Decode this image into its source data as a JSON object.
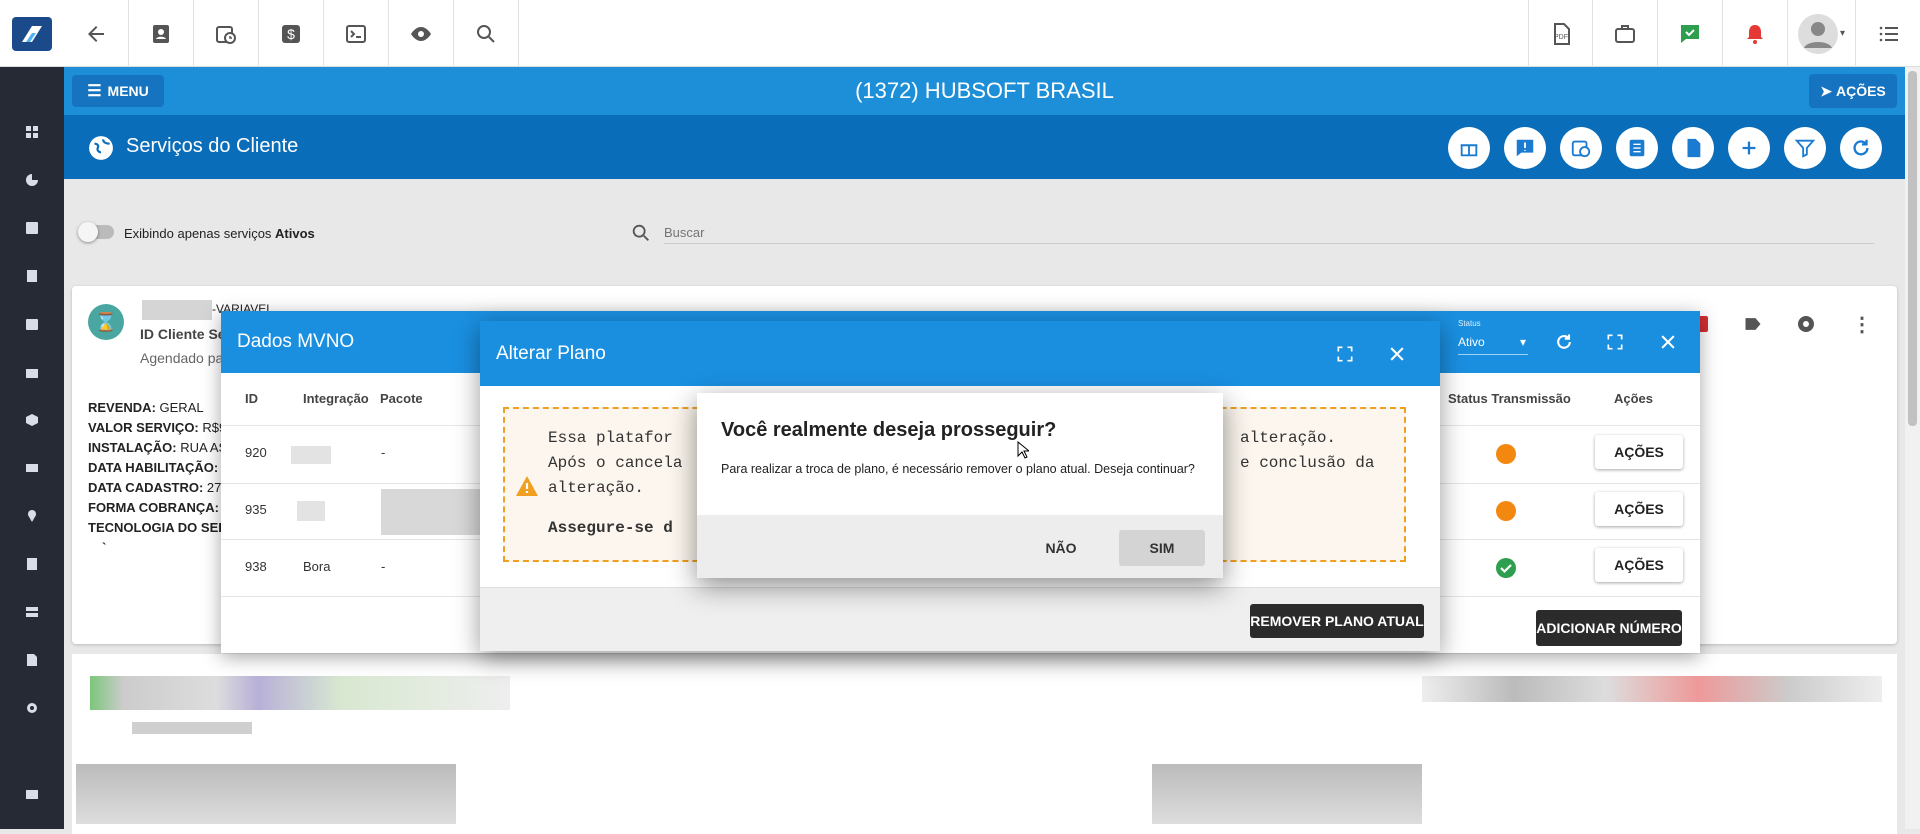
{
  "header": {
    "title": "(1372) HUBSOFT BRASIL",
    "menu_label": "MENU",
    "actions_label": "AÇÕES"
  },
  "subheader": {
    "title": "Serviços do Cliente"
  },
  "filter": {
    "label_prefix": "Exibindo apenas serviços ",
    "label_bold": "Ativos",
    "search_placeholder": "Buscar"
  },
  "card": {
    "name_suffix": "-VARIAVEL",
    "id_label": "ID Cliente Se",
    "agendado": "Agendado pa",
    "lines": [
      {
        "label": "REVENDA:",
        "value": " GERAL"
      },
      {
        "label": "VALOR SERVIÇO:",
        "value": " R$9"
      },
      {
        "label": "INSTALAÇÃO:",
        "value": " RUA AS"
      },
      {
        "label": "DATA HABILITAÇÃO:",
        "value": ""
      },
      {
        "label": "DATA CADASTRO:",
        "value": " 27"
      },
      {
        "label": "FORMA COBRANÇA:",
        "value": ""
      },
      {
        "label": "TECNOLOGIA DO SER",
        "value": ""
      }
    ],
    "tick": "`"
  },
  "mvno": {
    "title": "Dados MVNO",
    "status_label": "Status",
    "status_value": "Ativo",
    "columns": {
      "id": "ID",
      "integracao": "Integração",
      "pacote": "Pacote",
      "status": "Status Transmissão",
      "acoes": "Ações"
    },
    "rows": [
      {
        "id": "920",
        "integracao": "",
        "pacote": "-",
        "status_color": "#f2880f"
      },
      {
        "id": "935",
        "integracao": "",
        "pacote": "",
        "status_color": "#f2880f"
      },
      {
        "id": "938",
        "integracao": "Bora",
        "pacote": "-",
        "status_color": "#2e9e4f"
      }
    ],
    "row_action": "AÇÕES",
    "add_button": "ADICIONAR NÚMERO"
  },
  "alterar": {
    "title": "Alterar Plano",
    "warn_line1a": "Essa platafor",
    "warn_line1b": "alteração.",
    "warn_line2a": "Após o cancela",
    "warn_line2b": "e conclusão da",
    "warn_line3": "alteração.",
    "warn_bold": "Assegure-se d",
    "remove_button": "REMOVER PLANO ATUAL"
  },
  "confirm": {
    "title": "Você realmente deseja prosseguir?",
    "message": "Para realizar a troca de plano, é necessário remover o plano atual. Deseja continuar?",
    "no": "NÃO",
    "yes": "SIM"
  }
}
